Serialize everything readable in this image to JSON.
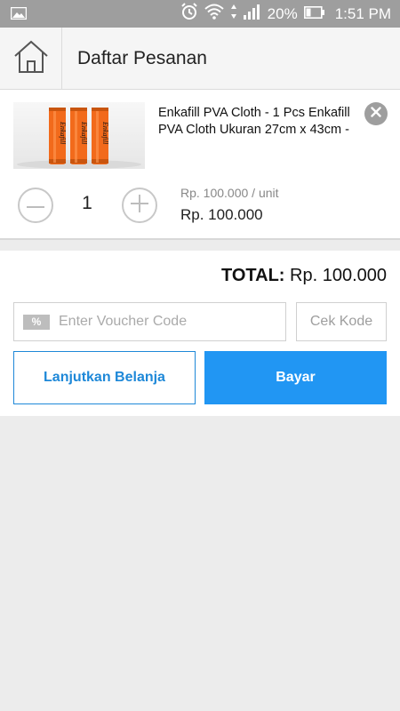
{
  "status_bar": {
    "battery_percent": "20%",
    "time": "1:51 PM",
    "icons": [
      "image-icon",
      "alarm-icon",
      "wifi-icon",
      "signal-icon",
      "battery-icon"
    ]
  },
  "header": {
    "title": "Daftar Pesanan",
    "home_icon": "home-icon"
  },
  "cart": {
    "items": [
      {
        "name": "Enkafill PVA Cloth - 1 Pcs Enkafill PVA Cloth Ukuran 27cm x 43cm -",
        "quantity": "1",
        "unit_price": "Rp. 100.000 / unit",
        "line_total": "Rp. 100.000",
        "product_label": "Enkafill"
      }
    ]
  },
  "summary": {
    "total_label": "TOTAL:",
    "total_value": "Rp. 100.000",
    "voucher_tag": "%",
    "voucher_placeholder": "Enter Voucher Code",
    "check_code_label": "Cek Kode",
    "continue_label": "Lanjutkan Belanja",
    "pay_label": "Bayar"
  },
  "colors": {
    "primary": "#2196f3",
    "primary_border": "#1e88d8",
    "status_bar": "#9e9e9e",
    "background": "#ececec",
    "product_orange": "#f26a1b"
  }
}
